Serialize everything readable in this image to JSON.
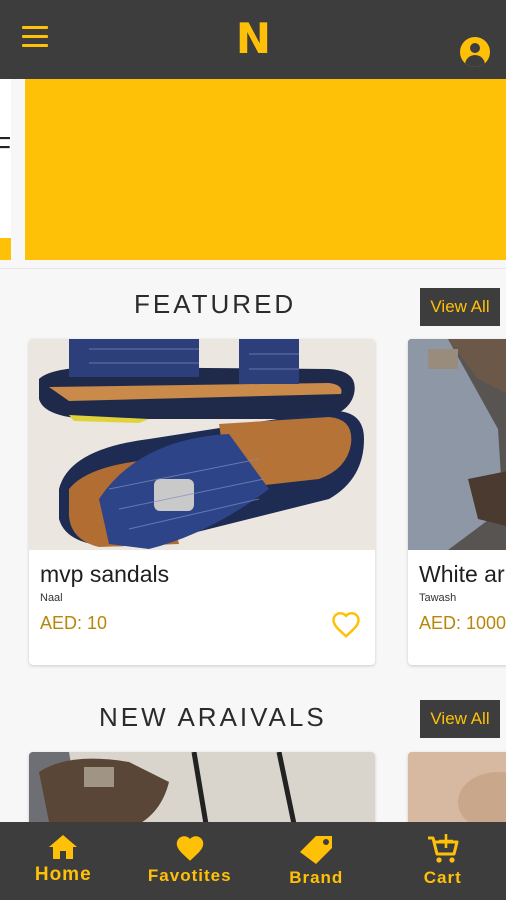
{
  "header": {
    "logo": "N",
    "icons": {
      "menu": "hamburger-menu-icon",
      "account": "account-circle-icon"
    }
  },
  "banner": {
    "prev_text": "F",
    "colors": {
      "accent": "#ffc107",
      "bar": "#3d3d3d"
    }
  },
  "featured": {
    "title": "FEATURED",
    "view_all_label": "View All",
    "products": [
      {
        "name": "mvp sandals",
        "brand": "Naal",
        "price": "AED: 10",
        "icon": "heart-outline-icon"
      },
      {
        "name": "White ar",
        "brand": "Tawash",
        "price": "AED: 1000"
      }
    ]
  },
  "new_arrivals": {
    "title": "NEW ARAIVALS",
    "view_all_label": "View All"
  },
  "bottom_nav": {
    "items": [
      {
        "label": "Home",
        "icon": "home-icon"
      },
      {
        "label": "Favotites",
        "icon": "heart-icon"
      },
      {
        "label": "Brand",
        "icon": "tag-icon"
      },
      {
        "label": "Cart",
        "icon": "cart-add-icon"
      }
    ]
  }
}
